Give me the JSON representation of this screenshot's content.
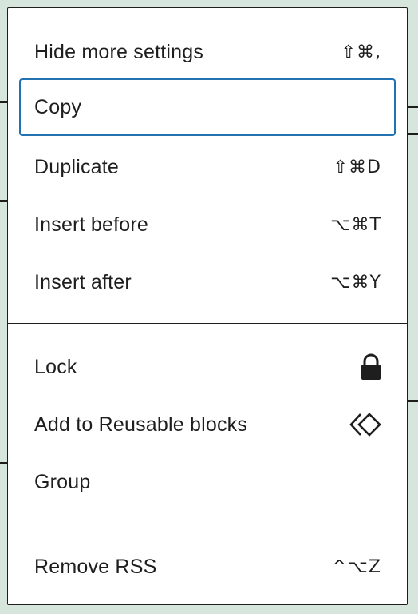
{
  "menu": {
    "sections": [
      {
        "items": [
          {
            "label": "Hide more settings",
            "shortcut": "⇧⌘,"
          },
          {
            "label": "Copy",
            "shortcut": ""
          },
          {
            "label": "Duplicate",
            "shortcut": "⇧⌘D"
          },
          {
            "label": "Insert before",
            "shortcut": "⌥⌘T"
          },
          {
            "label": "Insert after",
            "shortcut": "⌥⌘Y"
          }
        ]
      },
      {
        "items": [
          {
            "label": "Lock",
            "icon": "lock-icon"
          },
          {
            "label": "Add to Reusable blocks",
            "icon": "reusable-block-icon"
          },
          {
            "label": "Group"
          }
        ]
      },
      {
        "items": [
          {
            "label": "Remove RSS",
            "shortcut": "^⌥Z"
          }
        ]
      }
    ]
  },
  "colors": {
    "focus_border": "#2271b1",
    "text": "#1e1e1e",
    "backdrop": "#d7e6dd"
  }
}
